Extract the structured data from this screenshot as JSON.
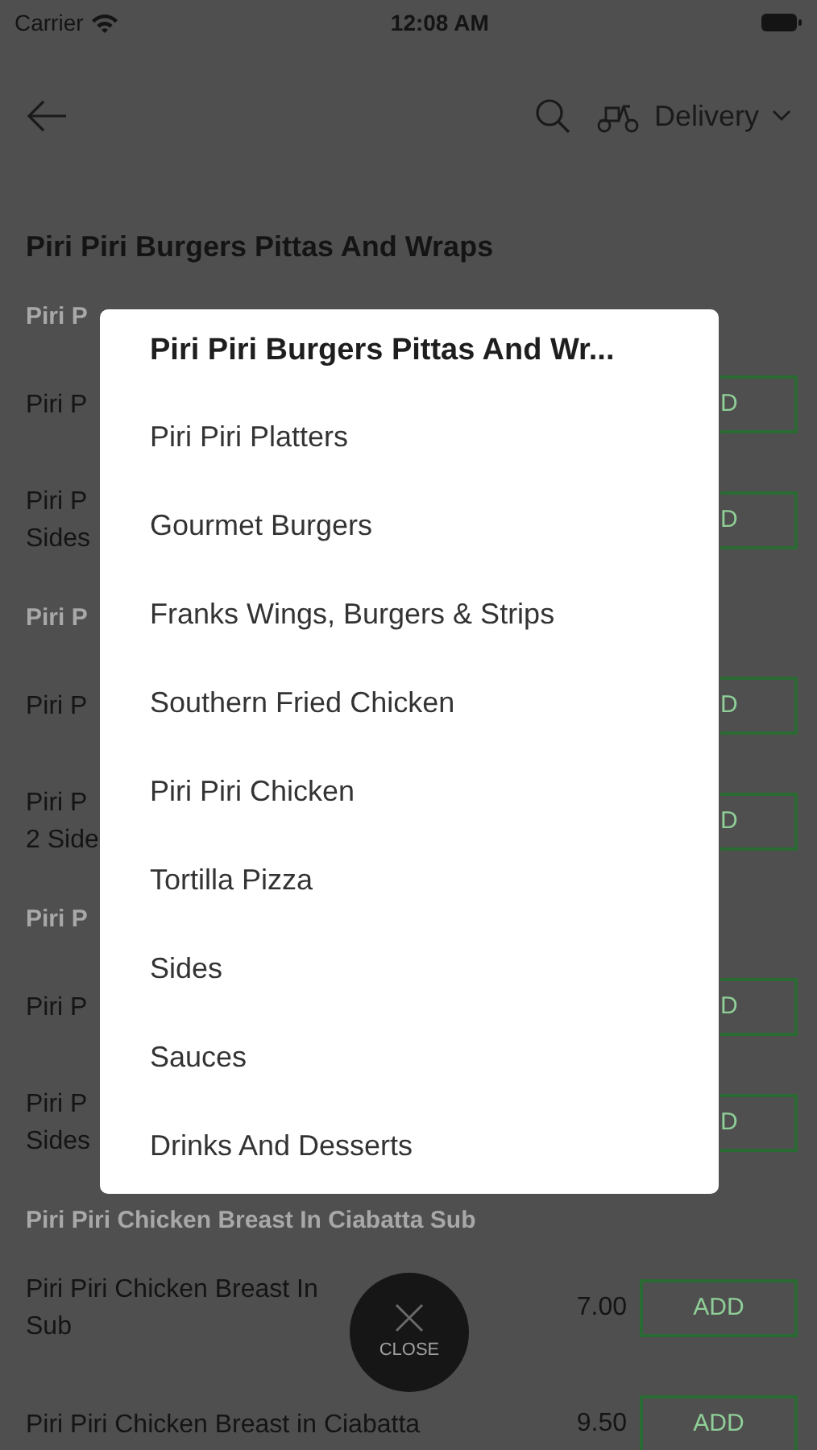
{
  "status_bar": {
    "carrier": "Carrier",
    "time": "12:08 AM"
  },
  "nav": {
    "order_mode": "Delivery"
  },
  "title": "Piri Piri Burgers Pittas And Wraps",
  "menu": [
    {
      "kind": "header",
      "text": "Piri P"
    },
    {
      "kind": "item",
      "lines": [
        "Piri P"
      ],
      "button": "D",
      "clipped": true
    },
    {
      "kind": "item",
      "lines": [
        "Piri P",
        "Sides"
      ],
      "button": "D",
      "clipped": true
    },
    {
      "kind": "header",
      "text": "Piri P"
    },
    {
      "kind": "item",
      "lines": [
        "Piri P"
      ],
      "button": "D",
      "clipped": true
    },
    {
      "kind": "item",
      "lines": [
        "Piri P",
        "2 Side"
      ],
      "button": "D",
      "clipped": true
    },
    {
      "kind": "header",
      "text": "Piri P"
    },
    {
      "kind": "item",
      "lines": [
        "Piri P"
      ],
      "button": "D",
      "clipped": true
    },
    {
      "kind": "item",
      "lines": [
        "Piri P",
        "Sides"
      ],
      "button": "D",
      "clipped": true
    },
    {
      "kind": "header",
      "text": "Piri Piri Chicken Breast In Ciabatta Sub"
    },
    {
      "kind": "item",
      "lines": [
        "Piri Piri Chicken Breast In",
        "Sub"
      ],
      "price": "7.00",
      "button": "ADD",
      "clipped": false
    },
    {
      "kind": "item",
      "lines": [
        "Piri Piri Chicken Breast in Ciabatta"
      ],
      "price": "9.50",
      "button": "ADD",
      "clipped": false
    }
  ],
  "category_menu": {
    "title": "Piri Piri Burgers Pittas And Wr...",
    "items": [
      "Piri Piri Platters",
      "Gourmet Burgers",
      "Franks Wings, Burgers & Strips",
      "Southern Fried Chicken",
      "Piri Piri Chicken",
      "Tortilla Pizza",
      "Sides",
      "Sauces",
      "Drinks And Desserts"
    ]
  },
  "close_button": {
    "label": "CLOSE"
  }
}
